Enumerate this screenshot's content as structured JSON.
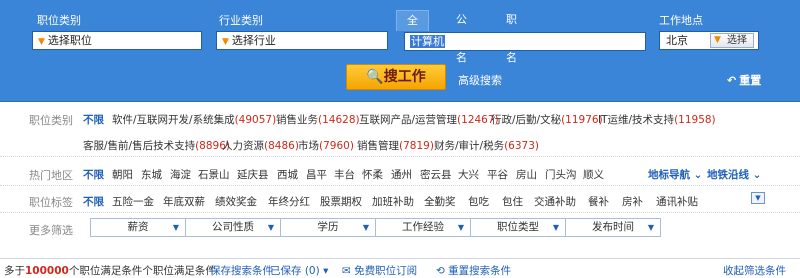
{
  "search": {
    "job_category_label": "职位类别",
    "job_category_value": "选择职位",
    "industry_label": "行业类别",
    "industry_value": "选择行业",
    "tabs": [
      "全文",
      "公司名",
      "职位名"
    ],
    "keyword_value": "计算机",
    "location_label": "工作地点",
    "location_value": "北京",
    "location_select": "选择",
    "search_button": "搜工作",
    "advanced_link": "高级搜索",
    "reset_label": "重置"
  },
  "filters": {
    "categories_label": "职位类别",
    "any": "不限",
    "categories_row1": [
      {
        "name": "软件/互联网开发/系统集成",
        "count": "(49057)"
      },
      {
        "name": "销售业务",
        "count": "(14628)"
      },
      {
        "name": "互联网产品/运营管理",
        "count": "(12467)"
      },
      {
        "name": "行政/后勤/文秘",
        "count": "(11976)"
      },
      {
        "name": "IT运维/技术支持",
        "count": "(11958)"
      }
    ],
    "categories_row2": [
      {
        "name": "客服/售前/售后技术支持",
        "count": "(8896)"
      },
      {
        "name": "人力资源",
        "count": "(8486)"
      },
      {
        "name": "市场",
        "count": "(7960)"
      },
      {
        "name": "销售管理",
        "count": "(7819)"
      },
      {
        "name": "财务/审计/税务",
        "count": "(6373)"
      }
    ],
    "area_label": "热门地区",
    "areas": [
      "朝阳",
      "东城",
      "海淀",
      "石景山",
      "延庆县",
      "西城",
      "昌平",
      "丰台",
      "怀柔",
      "通州",
      "密云县",
      "大兴",
      "平谷",
      "房山",
      "门头沟",
      "顺义"
    ],
    "landmark_nav": "地标导航",
    "metro_line": "地铁沿线",
    "tags_label": "职位标签",
    "tags": [
      "五险一金",
      "年底双薪",
      "绩效奖金",
      "年终分红",
      "股票期权",
      "加班补助",
      "全勤奖",
      "包吃",
      "包住",
      "交通补助",
      "餐补",
      "房补",
      "通讯补贴"
    ],
    "more_label": "更多筛选",
    "dropdowns": [
      "薪资",
      "公司性质",
      "学历",
      "工作经验",
      "职位类型",
      "发布时间"
    ]
  },
  "bottom": {
    "prefix": "多于",
    "count": "100000",
    "suffix": "个职位满足条件",
    "suffix2": "个职位满足条件",
    "save_search": "保存搜索条件",
    "saved": "已保存 (0)",
    "free_subscribe": "免费职位订阅",
    "reset_search": "重置搜索条件",
    "collapse": "收起筛选条件"
  }
}
